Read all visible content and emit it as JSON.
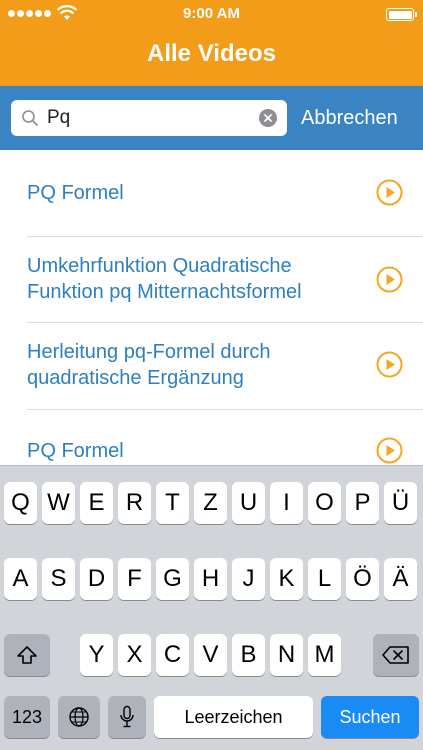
{
  "status_bar": {
    "time": "9:00 AM"
  },
  "header": {
    "title": "Alle Videos"
  },
  "search": {
    "value": "Pq",
    "cancel_label": "Abbrechen"
  },
  "results": [
    {
      "title": "PQ Formel"
    },
    {
      "title": "Umkehrfunktion Quadratische\nFunktion pq Mitternachtsformel"
    },
    {
      "title": "Herleitung pq-Formel durch\nquadratische Ergänzung"
    },
    {
      "title": "PQ Formel"
    }
  ],
  "keyboard": {
    "row1": [
      "Q",
      "W",
      "E",
      "R",
      "T",
      "Z",
      "U",
      "I",
      "O",
      "P",
      "Ü"
    ],
    "row2": [
      "A",
      "S",
      "D",
      "F",
      "G",
      "H",
      "J",
      "K",
      "L",
      "Ö",
      "Ä"
    ],
    "row3": [
      "Y",
      "X",
      "C",
      "V",
      "B",
      "N",
      "M"
    ],
    "numbers_label": "123",
    "space_label": "Leerzeichen",
    "go_label": "Suchen"
  },
  "colors": {
    "header": "#f39c19",
    "search_bar": "#3b84c4",
    "link": "#2e7fbf",
    "play_icon": "#f5a623",
    "go_key": "#1a8af5"
  }
}
